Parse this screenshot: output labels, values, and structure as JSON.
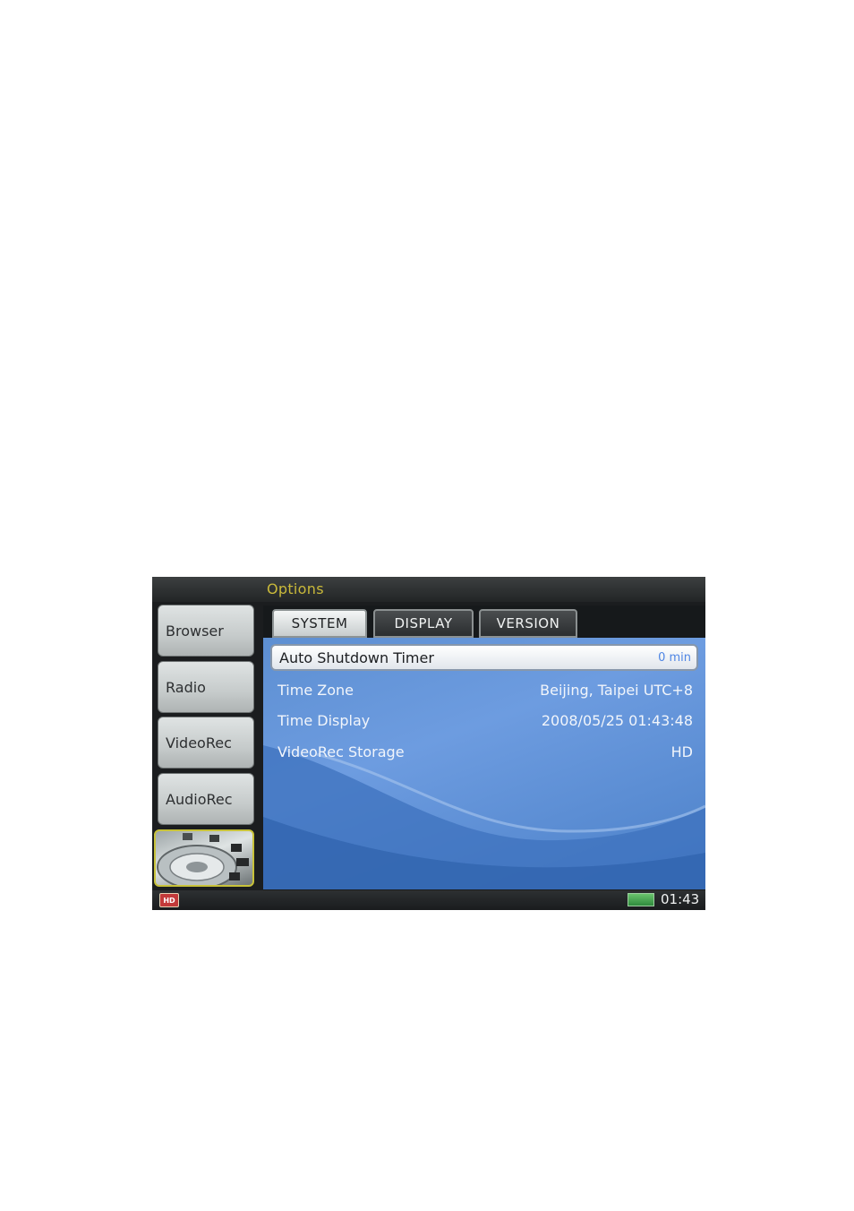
{
  "window": {
    "title": "Options"
  },
  "sidebar": {
    "items": [
      {
        "label": "Browser"
      },
      {
        "label": "Radio"
      },
      {
        "label": "VideoRec"
      },
      {
        "label": "AudioRec"
      }
    ]
  },
  "tabs": [
    {
      "label": "SYSTEM",
      "active": true
    },
    {
      "label": "DISPLAY",
      "active": false
    },
    {
      "label": "VERSION",
      "active": false
    }
  ],
  "settings": {
    "rows": [
      {
        "label": "Auto Shutdown Timer",
        "value": "0 min",
        "selected": true
      },
      {
        "label": "Time Zone",
        "value": "Beijing, Taipei UTC+8"
      },
      {
        "label": "Time Display",
        "value": "2008/05/25 01:43:48"
      },
      {
        "label": "VideoRec Storage",
        "value": "HD"
      }
    ]
  },
  "status": {
    "storage_badge": "HD",
    "clock": "01:43",
    "battery_icon": "battery-icon"
  },
  "colors": {
    "title_accent": "#c9b93a",
    "panel_blue": "#6d9ce0",
    "selected_value": "#4f86e4"
  }
}
